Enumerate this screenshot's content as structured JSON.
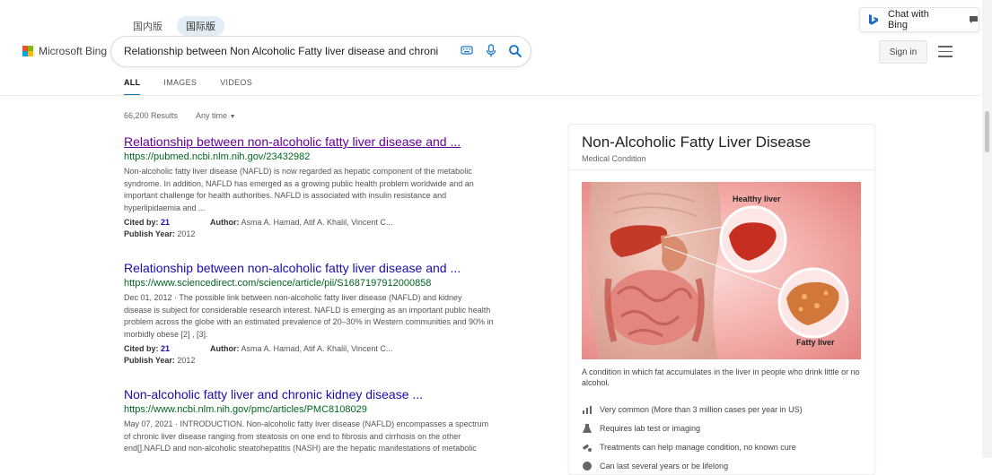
{
  "header": {
    "region_tabs": [
      "国内版",
      "国际版"
    ],
    "logo_text": "Microsoft Bing",
    "search_query": "Relationship between Non Alcoholic Fatty liver disease and chronic",
    "chat_label": "Chat with Bing",
    "signin_label": "Sign in"
  },
  "nav": {
    "tabs": [
      "ALL",
      "IMAGES",
      "VIDEOS"
    ]
  },
  "results_meta": {
    "count": "66,200 Results",
    "filter": "Any time"
  },
  "results": [
    {
      "title": "Relationship between non-alcoholic fatty liver disease and ...",
      "url": "https://pubmed.ncbi.nlm.nih.gov/23432982",
      "snippet_lines": [
        "Non-alcoholic fatty liver disease (NAFLD) is now regarded as hepatic component of the metabolic",
        "syndrome. In addition, NAFLD has emerged as a growing public health problem worldwide and an",
        "important challenge for health authorities. NAFLD is associated with insulin resistance and",
        "hyperlipidaemia and ..."
      ],
      "cited_label": "Cited by:",
      "cited_value": "21",
      "author_label": "Author:",
      "author_value": "Asma A. Hamad, Atif A. Khalil, Vincent C...",
      "year_label": "Publish Year:",
      "year_value": "2012"
    },
    {
      "title": "Relationship between non-alcoholic fatty liver disease and ...",
      "url": "https://www.sciencedirect.com/science/article/pii/S1687197912000858",
      "snippet_lines": [
        "Dec 01, 2012 · The possible link between non-alcoholic fatty liver disease (NAFLD) and kidney",
        "disease is subject for considerable research interest. NAFLD is emerging as an important public health",
        "problem across the globe with an estimated prevalence of 20–30% in Western communities and 90% in",
        "morbidly obese [2] , [3]."
      ],
      "cited_label": "Cited by:",
      "cited_value": "21",
      "author_label": "Author:",
      "author_value": "Asma A. Hamad, Atif A. Khalil, Vincent C...",
      "year_label": "Publish Year:",
      "year_value": "2012"
    },
    {
      "title": "Non-alcoholic fatty liver and chronic kidney disease ...",
      "url": "https://www.ncbi.nlm.nih.gov/pmc/articles/PMC8108029",
      "snippet_lines": [
        "May 07, 2021 · INTRODUCTION. Non-alcoholic fatty liver disease (NAFLD) encompasses a spectrum",
        "of chronic liver disease ranging from steatosis on one end to fibrosis and cirrhosis on the other",
        "end[].NAFLD and non-alcoholic steatohepatitis (NASH) are the hepatic manifestations of metabolic"
      ]
    }
  ],
  "knowledge_panel": {
    "title": "Non-Alcoholic Fatty Liver Disease",
    "subtitle": "Medical Condition",
    "image_labels": {
      "healthy": "Healthy liver",
      "fatty": "Fatty liver"
    },
    "description": "A condition in which fat accumulates in the liver in people who drink little or no alcohol.",
    "facts": [
      "Very common (More than 3 million cases per year in US)",
      "Requires lab test or imaging",
      "Treatments can help manage condition, no known cure",
      "Can last several years or be lifelong"
    ]
  },
  "colors": {
    "accent": "#1773c8",
    "link": "#1a0dab",
    "visited": "#660099",
    "url": "#006621"
  }
}
